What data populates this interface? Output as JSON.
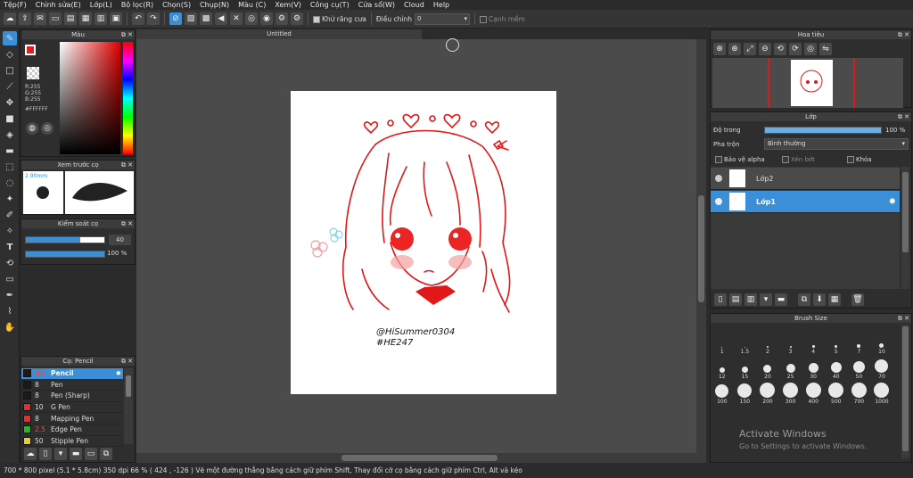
{
  "menu": [
    "Tệp(F)",
    "Chỉnh sửa(E)",
    "Lớp(L)",
    "Bộ lọc(R)",
    "Chọn(S)",
    "Chụp(N)",
    "Màu (C)",
    "Xem(V)",
    "Công cụ(T)",
    "Cửa sổ(W)",
    "Cloud",
    "Help"
  ],
  "toolbar": {
    "antialias_label": "Khử răng cưa",
    "adjust_label": "Điều chỉnh",
    "adjust_value": "0",
    "smooth_label": "Cạnh mềm"
  },
  "color_panel": {
    "title": "Màu",
    "r": "R:255",
    "g": "G:255",
    "b": "B:255",
    "hex": "#FFFFFF",
    "fg_color": "#e02020",
    "bg_color": "#ffffff"
  },
  "brush_preview": {
    "title": "Xem trước cọ",
    "size": "2.90mm"
  },
  "brush_control": {
    "title": "Kiểm soát cọ",
    "size_value": "40",
    "opacity_value": "100 %",
    "size_fraction": 0.69,
    "opacity_fraction": 1.0
  },
  "brush_list": {
    "title": "Cọ: Pencil",
    "items": [
      {
        "size": "40",
        "name": "Pencil",
        "color": "#1a1a1a",
        "active": true
      },
      {
        "size": "8",
        "name": "Pen",
        "color": "#1a1a1a"
      },
      {
        "size": "8",
        "name": "Pen (Sharp)",
        "color": "#1a1a1a"
      },
      {
        "size": "10",
        "name": "G Pen",
        "color": "#e03030"
      },
      {
        "size": "8",
        "name": "Mapping Pen",
        "color": "#e03030"
      },
      {
        "size": "2.5",
        "name": "Edge Pen",
        "color": "#30b030"
      },
      {
        "size": "50",
        "name": "Stipple Pen",
        "color": "#e8d020"
      }
    ]
  },
  "document": {
    "tab_title": "Untitled"
  },
  "artwork": {
    "signature_line1": "@HiSummer0304",
    "signature_line2": "#HE247"
  },
  "navigator": {
    "title": "Hoa tiêu"
  },
  "layer_panel": {
    "title": "Lớp",
    "opacity_label": "Độ trong",
    "opacity_value": "100 %",
    "opacity_fraction": 1.0,
    "blend_label": "Pha trộn",
    "blend_value": "Bình thường",
    "protect_alpha": "Bảo vệ alpha",
    "clipping": "Xén bớt",
    "lock": "Khóa",
    "layers": [
      {
        "name": "Lớp2",
        "active": false
      },
      {
        "name": "Lớp1",
        "active": true
      }
    ]
  },
  "brush_size": {
    "title": "Brush Size",
    "sizes": [
      "1",
      "1.5",
      "2",
      "3",
      "4",
      "5",
      "7",
      "10",
      "12",
      "15",
      "20",
      "25",
      "30",
      "40",
      "50",
      "70",
      "100",
      "150",
      "200",
      "300",
      "400",
      "500",
      "700",
      "1000"
    ]
  },
  "watermark": {
    "line1": "Activate Windows",
    "line2": "Go to Settings to activate Windows."
  },
  "status": {
    "text": "700 * 800 pixel   (5.1 * 5.8cm)   350 dpi   66 %   ( 424 , -126 )   Vẽ một đường thẳng bằng cách giữ phím Shift, Thay đổi cỡ cọ bằng cách giữ phím Ctrl, Alt và kéo"
  }
}
